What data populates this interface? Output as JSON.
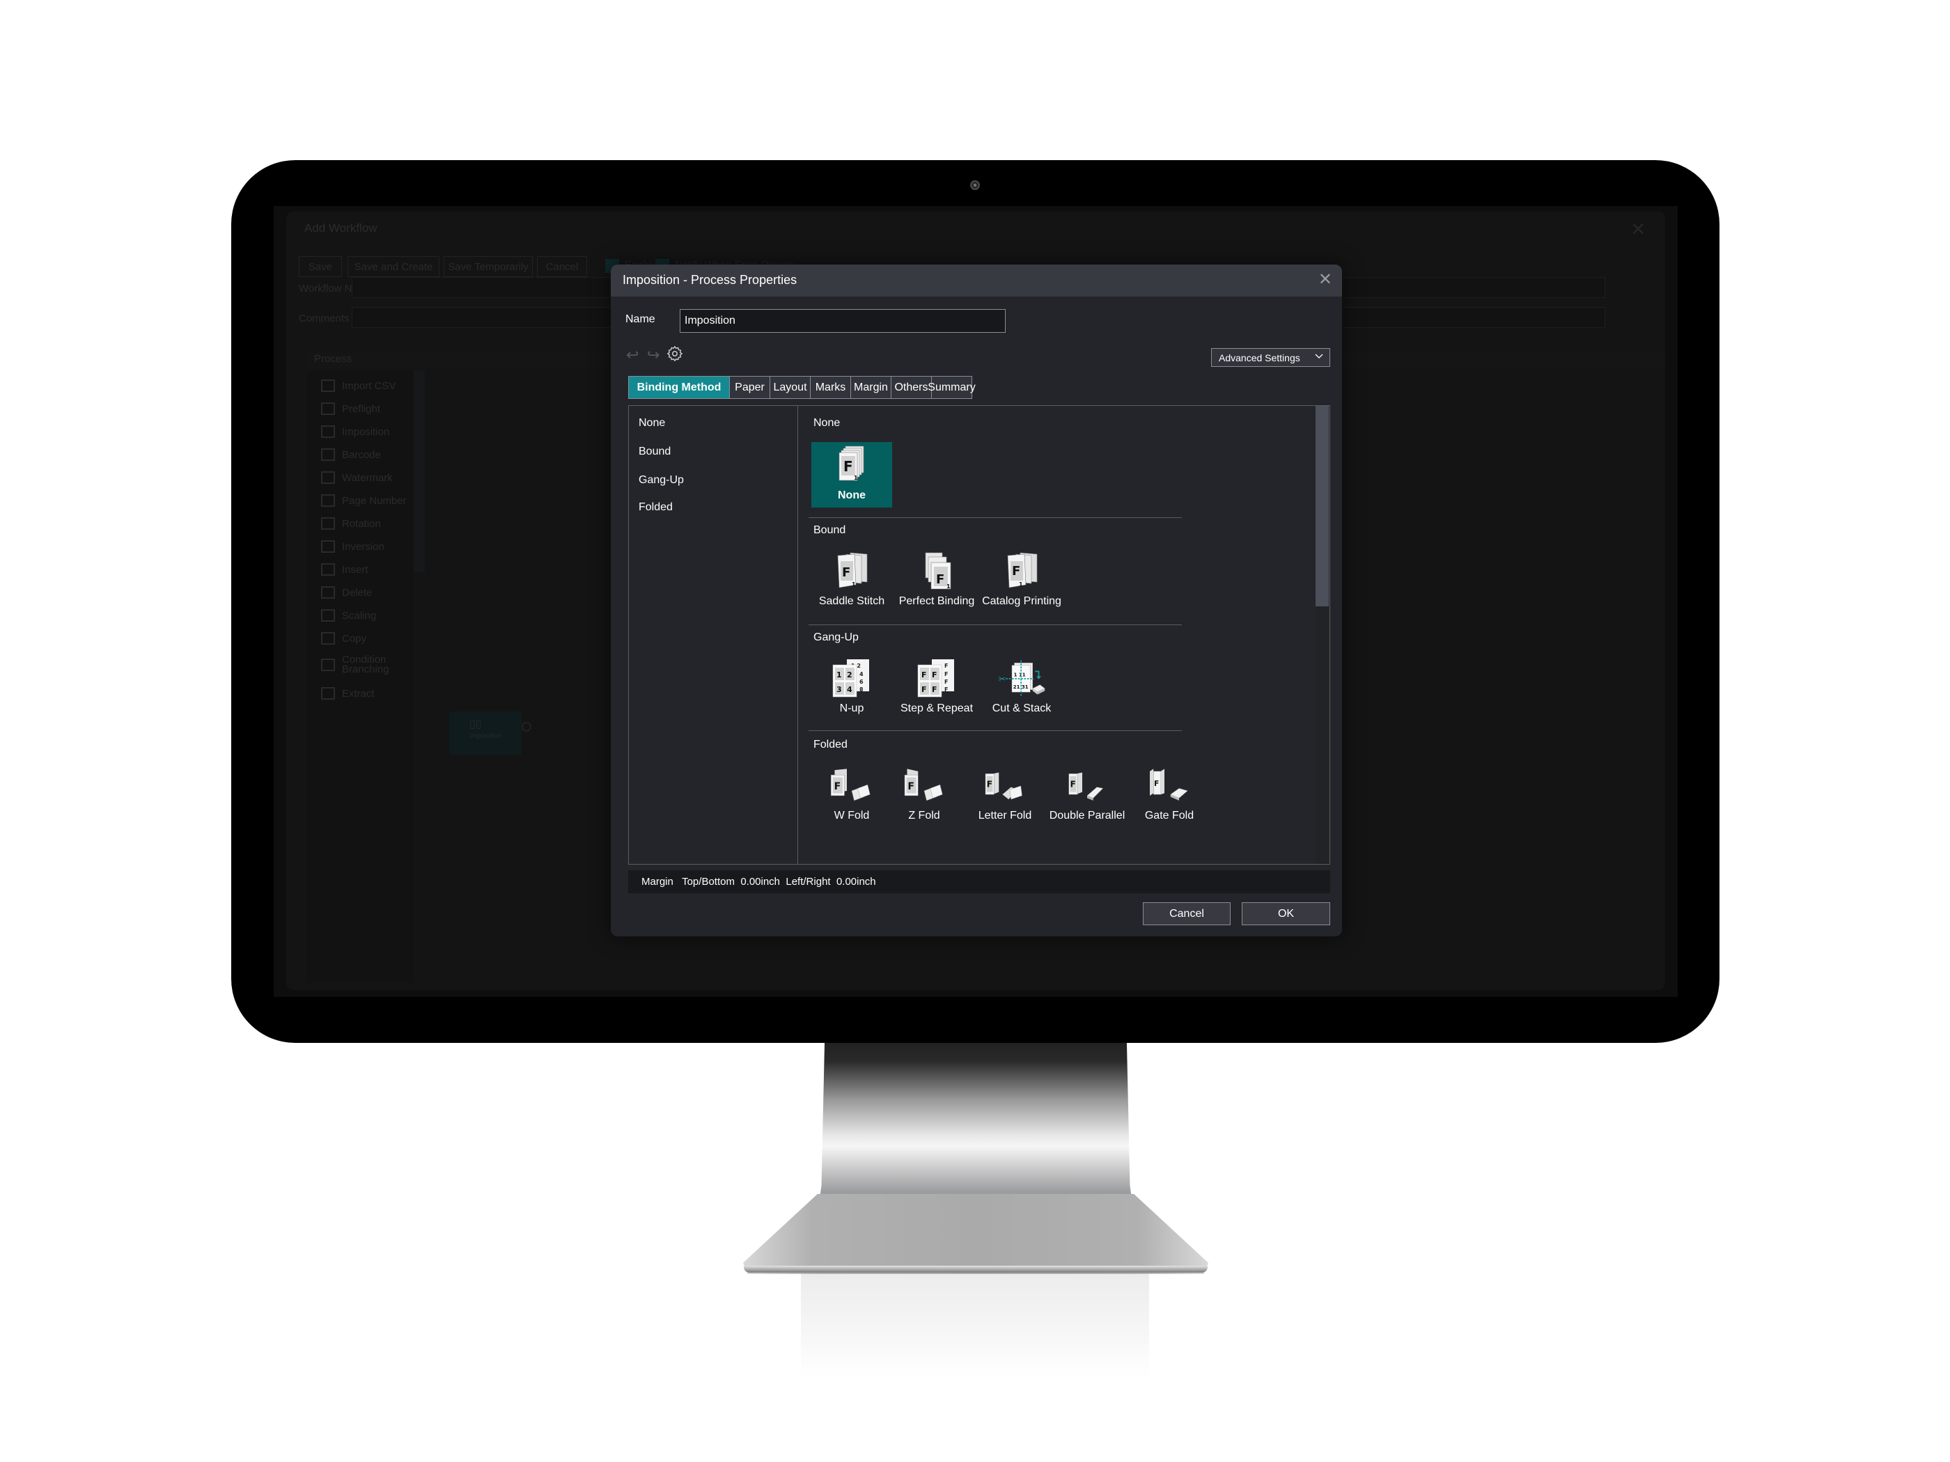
{
  "background_app": {
    "title": "Add Workflow",
    "toolbar": [
      "Save",
      "Save and Create Hot Folder",
      "Save Temporarily",
      "Cancel"
    ],
    "checkboxes": [
      "Enable",
      "Notify When Error Occurs"
    ],
    "fields": {
      "workflow_name_label": "Workflow Name",
      "comments_label": "Comments"
    },
    "process_label": "Process",
    "process_items": [
      {
        "label": "Import CSV",
        "icon": "csv-icon"
      },
      {
        "label": "Preflight",
        "icon": "preflight-icon"
      },
      {
        "label": "Imposition",
        "icon": "book-icon"
      },
      {
        "label": "Barcode",
        "icon": "qr-icon"
      },
      {
        "label": "Watermark",
        "icon": "abc-icon"
      },
      {
        "label": "Page Number",
        "icon": "page-number-icon"
      },
      {
        "label": "Rotation",
        "icon": "rotation-icon"
      },
      {
        "label": "Inversion",
        "icon": "inversion-icon"
      },
      {
        "label": "Insert",
        "icon": "insert-icon"
      },
      {
        "label": "Delete",
        "icon": "delete-icon"
      },
      {
        "label": "Scaling",
        "icon": "scaling-icon"
      },
      {
        "label": "Copy",
        "icon": "copy-icon"
      },
      {
        "label": "Condition Branching",
        "icon": "branch-icon"
      },
      {
        "label": "Extract",
        "icon": "extract-icon"
      }
    ],
    "canvas_node": "Imposition"
  },
  "dialog": {
    "title": "Imposition - Process Properties",
    "close_icon": "close-icon",
    "name_label": "Name",
    "name_value": "Imposition",
    "advanced_settings_label": "Advanced Settings",
    "tabs": [
      {
        "label": "Binding Method",
        "active": true
      },
      {
        "label": "Paper",
        "active": false
      },
      {
        "label": "Layout",
        "active": false
      },
      {
        "label": "Marks",
        "active": false
      },
      {
        "label": "Margin",
        "active": false
      },
      {
        "label": "Others",
        "active": false
      },
      {
        "label": "Summary",
        "active": false
      }
    ],
    "categories": [
      "None",
      "Bound",
      "Gang-Up",
      "Folded"
    ],
    "sections": [
      {
        "title": "None",
        "options": [
          {
            "label": "None",
            "icon": "single-sheets-icon",
            "selected": true
          }
        ]
      },
      {
        "title": "Bound",
        "options": [
          {
            "label": "Saddle Stitch",
            "icon": "saddle-stitch-icon"
          },
          {
            "label": "Perfect Binding",
            "icon": "perfect-binding-icon"
          },
          {
            "label": "Catalog Printing",
            "icon": "catalog-printing-icon"
          }
        ]
      },
      {
        "title": "Gang-Up",
        "options": [
          {
            "label": "N-up",
            "icon": "n-up-icon"
          },
          {
            "label": "Step & Repeat",
            "icon": "step-repeat-icon"
          },
          {
            "label": "Cut & Stack",
            "icon": "cut-stack-icon"
          }
        ]
      },
      {
        "title": "Folded",
        "options": [
          {
            "label": "W Fold",
            "icon": "w-fold-icon"
          },
          {
            "label": "Z Fold",
            "icon": "z-fold-icon"
          },
          {
            "label": "Letter Fold",
            "icon": "letter-fold-icon"
          },
          {
            "label": "Double Parallel",
            "icon": "double-parallel-icon"
          },
          {
            "label": "Gate Fold",
            "icon": "gate-fold-icon"
          }
        ]
      }
    ],
    "footer": {
      "margin_label": "Margin",
      "top_bottom_label": "Top/Bottom",
      "top_bottom_value": "0.00inch",
      "left_right_label": "Left/Right",
      "left_right_value": "0.00inch"
    },
    "cancel_label": "Cancel",
    "ok_label": "OK"
  },
  "colors": {
    "accent_teal": "#138a91",
    "selected_option": "#03605f",
    "dialog_bg": "#24252a",
    "titlebar_bg": "#383a41"
  }
}
